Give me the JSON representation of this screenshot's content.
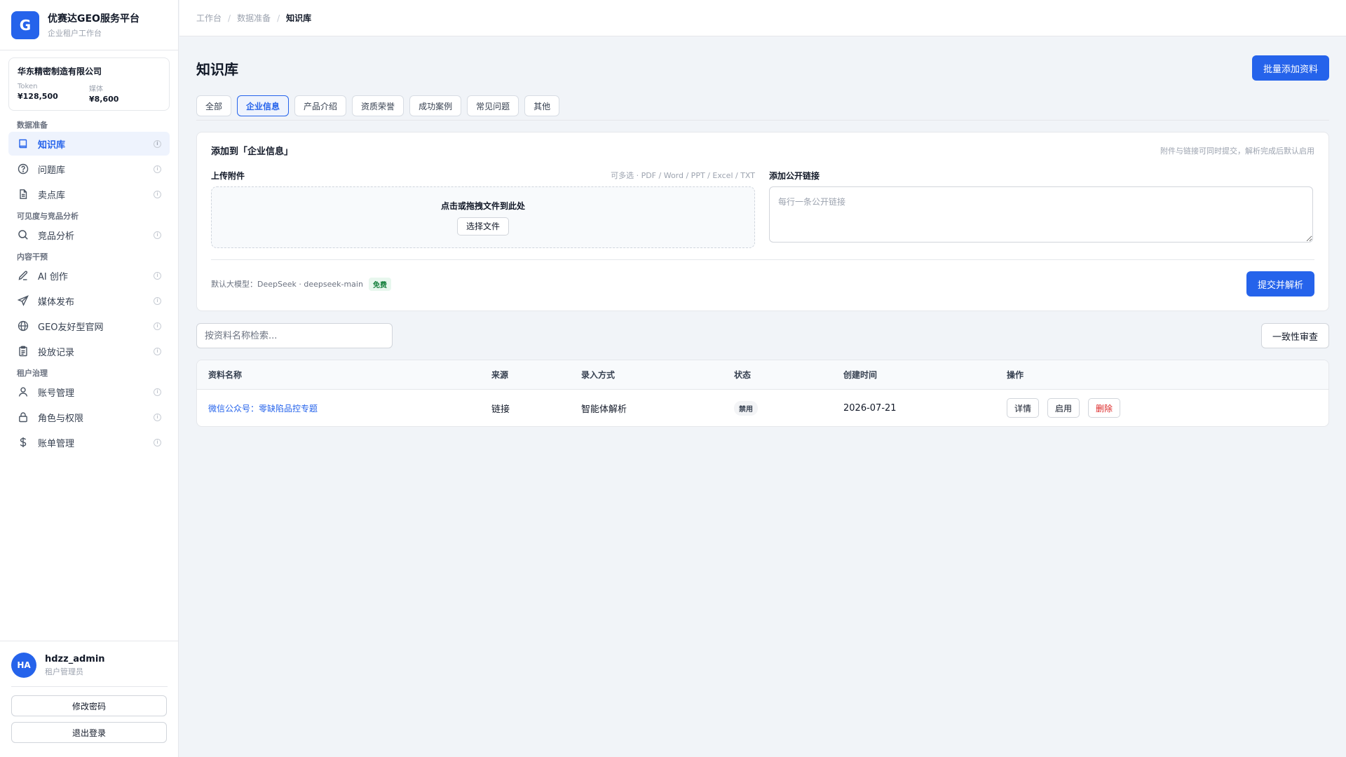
{
  "brand": {
    "logo": "G",
    "title": "优赛达GEO服务平台",
    "subtitle": "企业租户工作台"
  },
  "tenant": {
    "name": "华东精密制造有限公司",
    "token_label": "Token",
    "token_value": "¥128,500",
    "media_label": "媒体",
    "media_value": "¥8,600"
  },
  "nav": {
    "group1": "数据准备",
    "g1": [
      {
        "label": "知识库",
        "icon": "book-icon"
      },
      {
        "label": "问题库",
        "icon": "question-circle-icon"
      },
      {
        "label": "卖点库",
        "icon": "document-icon"
      }
    ],
    "group2": "可见度与竞品分析",
    "g2": [
      {
        "label": "竞品分析",
        "icon": "search-icon"
      }
    ],
    "group3": "内容干预",
    "g3": [
      {
        "label": "AI 创作",
        "icon": "pen-icon"
      },
      {
        "label": "媒体发布",
        "icon": "send-icon"
      },
      {
        "label": "GEO友好型官网",
        "icon": "globe-icon"
      },
      {
        "label": "投放记录",
        "icon": "clipboard-icon"
      }
    ],
    "group4": "租户治理",
    "g4": [
      {
        "label": "账号管理",
        "icon": "user-icon"
      },
      {
        "label": "角色与权限",
        "icon": "lock-icon"
      },
      {
        "label": "账单管理",
        "icon": "dollar-icon"
      }
    ]
  },
  "user": {
    "initials": "HA",
    "name": "hdzz_admin",
    "role": "租户管理员",
    "change_password": "修改密码",
    "logout": "退出登录"
  },
  "breadcrumb": {
    "items": [
      "工作台",
      "数据准备"
    ],
    "current": "知识库"
  },
  "page": {
    "title": "知识库",
    "bulk_add": "批量添加资料"
  },
  "tabs": [
    "全部",
    "企业信息",
    "产品介绍",
    "资质荣誉",
    "成功案例",
    "常见问题",
    "其他"
  ],
  "upload_card": {
    "title": "添加到「企业信息」",
    "hint": "附件与链接可同时提交，解析完成后默认启用",
    "attach_label": "上传附件",
    "attach_note": "可多选 · PDF / Word / PPT / Excel / TXT",
    "drop_text": "点击或拖拽文件到此处",
    "choose_file": "选择文件",
    "link_label": "添加公开链接",
    "link_placeholder": "每行一条公开链接",
    "model_text": "默认大模型：DeepSeek · deepseek-main",
    "free_badge": "免费",
    "submit": "提交并解析"
  },
  "search": {
    "placeholder": "按资料名称检索..."
  },
  "consistency_button": "一致性审查",
  "table": {
    "headers": [
      "资料名称",
      "来源",
      "录入方式",
      "状态",
      "创建时间",
      "操作"
    ],
    "rows": [
      {
        "name": "微信公众号：零缺陷品控专题",
        "source": "链接",
        "method": "智能体解析",
        "status": "禁用",
        "created": "2026-07-21",
        "actions": [
          "详情",
          "启用",
          "删除"
        ]
      }
    ]
  },
  "colors": {
    "accent": "#2563eb",
    "danger": "#dc2626",
    "free": "#15803d"
  }
}
